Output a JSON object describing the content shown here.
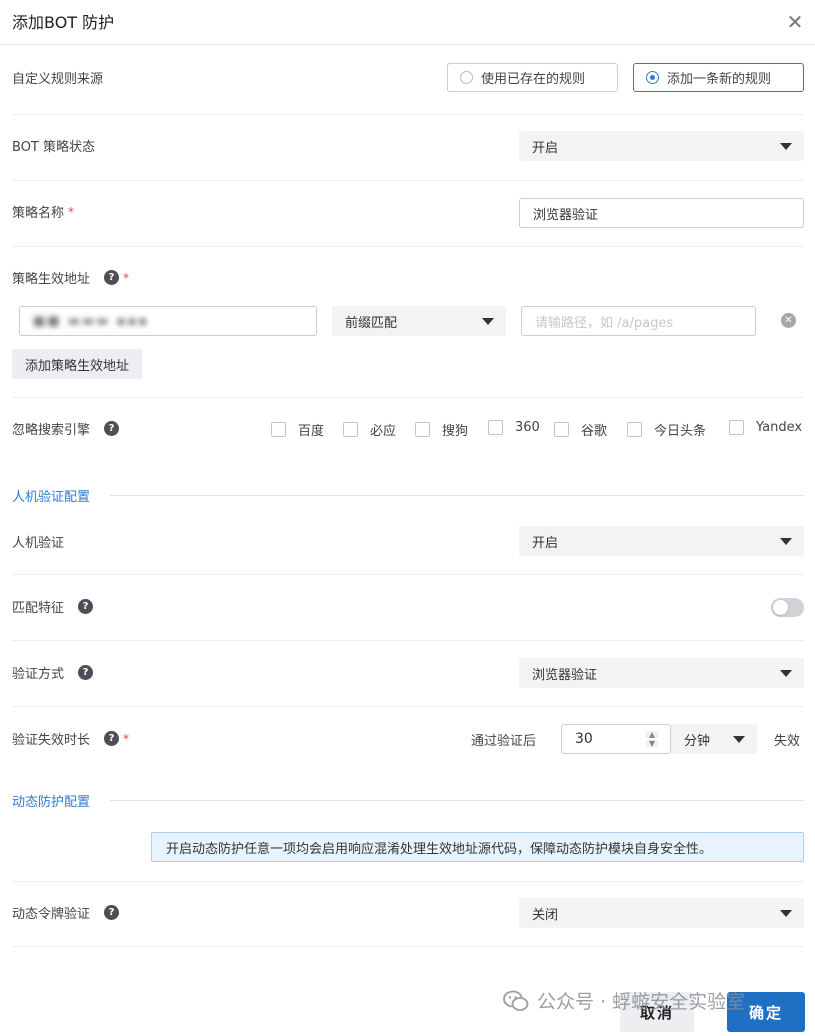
{
  "dialog": {
    "title": "添加BOT 防护"
  },
  "rule_source": {
    "label": "自定义规则来源",
    "options": [
      "使用已存在的规则",
      "添加一条新的规则"
    ],
    "selected": "添加一条新的规则"
  },
  "policy_status": {
    "label": "BOT 策略状态",
    "value": "开启"
  },
  "policy_name": {
    "label": "策略名称",
    "value": "浏览器验证"
  },
  "effective_address": {
    "label": "策略生效地址",
    "domain_value": "■■ ▬▬▬ ▪▪▪",
    "match_type": "前缀匹配",
    "path_placeholder": "请输路径，如 /a/pages",
    "add_button": "添加策略生效地址"
  },
  "ignore_engines": {
    "label": "忽略搜索引擎",
    "options": [
      "百度",
      "必应",
      "搜狗",
      "360",
      "谷歌",
      "今日头条",
      "Yandex"
    ]
  },
  "captcha_section": {
    "title": "人机验证配置",
    "captcha": {
      "label": "人机验证",
      "value": "开启"
    },
    "match_features": {
      "label": "匹配特征",
      "enabled": false
    },
    "verify_method": {
      "label": "验证方式",
      "value": "浏览器验证"
    },
    "expiry": {
      "label": "验证失效时长",
      "prefix": "通过验证后",
      "value": "30",
      "unit": "分钟",
      "suffix": "失效"
    }
  },
  "dynamic_section": {
    "title": "动态防护配置",
    "notice": "开启动态防护任意一项均会启用响应混淆处理生效地址源代码，保障动态防护模块自身安全性。",
    "token_verify": {
      "label": "动态令牌验证",
      "value": "关闭"
    }
  },
  "footer": {
    "cancel": "取消",
    "confirm": "确定",
    "watermark": "公众号 · 蜉蝣安全实验室"
  },
  "colors": {
    "accent": "#2f7bd0",
    "primary_button": "#1f6fc5",
    "notice_bg": "#e8f4fd",
    "required": "#e5484d"
  }
}
